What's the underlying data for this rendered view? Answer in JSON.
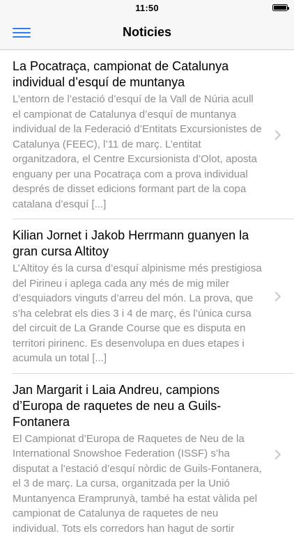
{
  "status_bar": {
    "time": "11:50"
  },
  "nav": {
    "title": "Noticies"
  },
  "articles": [
    {
      "headline": "La Pocatraça, campionat de Catalunya individual d’esquí de muntanya",
      "summary": "L’entorn de l’estació d’esquí de la Vall de Núria acull el campionat de Catalunya d’esquí de muntanya individual de la Federació d’Entitats Excursionistes de Catalunya (FEEC), l’11 de març. L’entitat organitzadora, el Centre Excursionista d’Olot, aposta enguany per una Pocatraça com a prova individual després de disset edicions formant part de la copa catalana d’esquí [...]"
    },
    {
      "headline": "Kilian Jornet i Jakob Herrmann guanyen la gran cursa Altitoy",
      "summary": "L’Altitoy és la cursa d’esquí alpinisme més prestigiosa del Pirineu i aplega cada any més de mig miler d’esquiadors vinguts d’arreu del món. La prova, que s’ha celebrat els dies 3 i 4 de març, és l’única cursa del circuit de La Grande Course que es disputa en territori pirinenc. Es desenvolupa en dues etapes i acumula un total [...]"
    },
    {
      "headline": "Jan Margarit i Laia Andreu, campions d’Europa de raquetes de neu a Guils-Fontanera",
      "summary": "El Campionat d’Europa de Raquetes de Neu de la International Snowshoe Federation (ISSF) s’ha disputat a l’estació d’esquí nòrdic de Guils-Fontanera, el 3 de març. La cursa, organitzada per la Unió Muntanyenca Eramprunyà, també ha estat vàlida pel campionat de Catalunya de raquetes de neu individual. Tots els corredors han hagut de sortir"
    }
  ]
}
